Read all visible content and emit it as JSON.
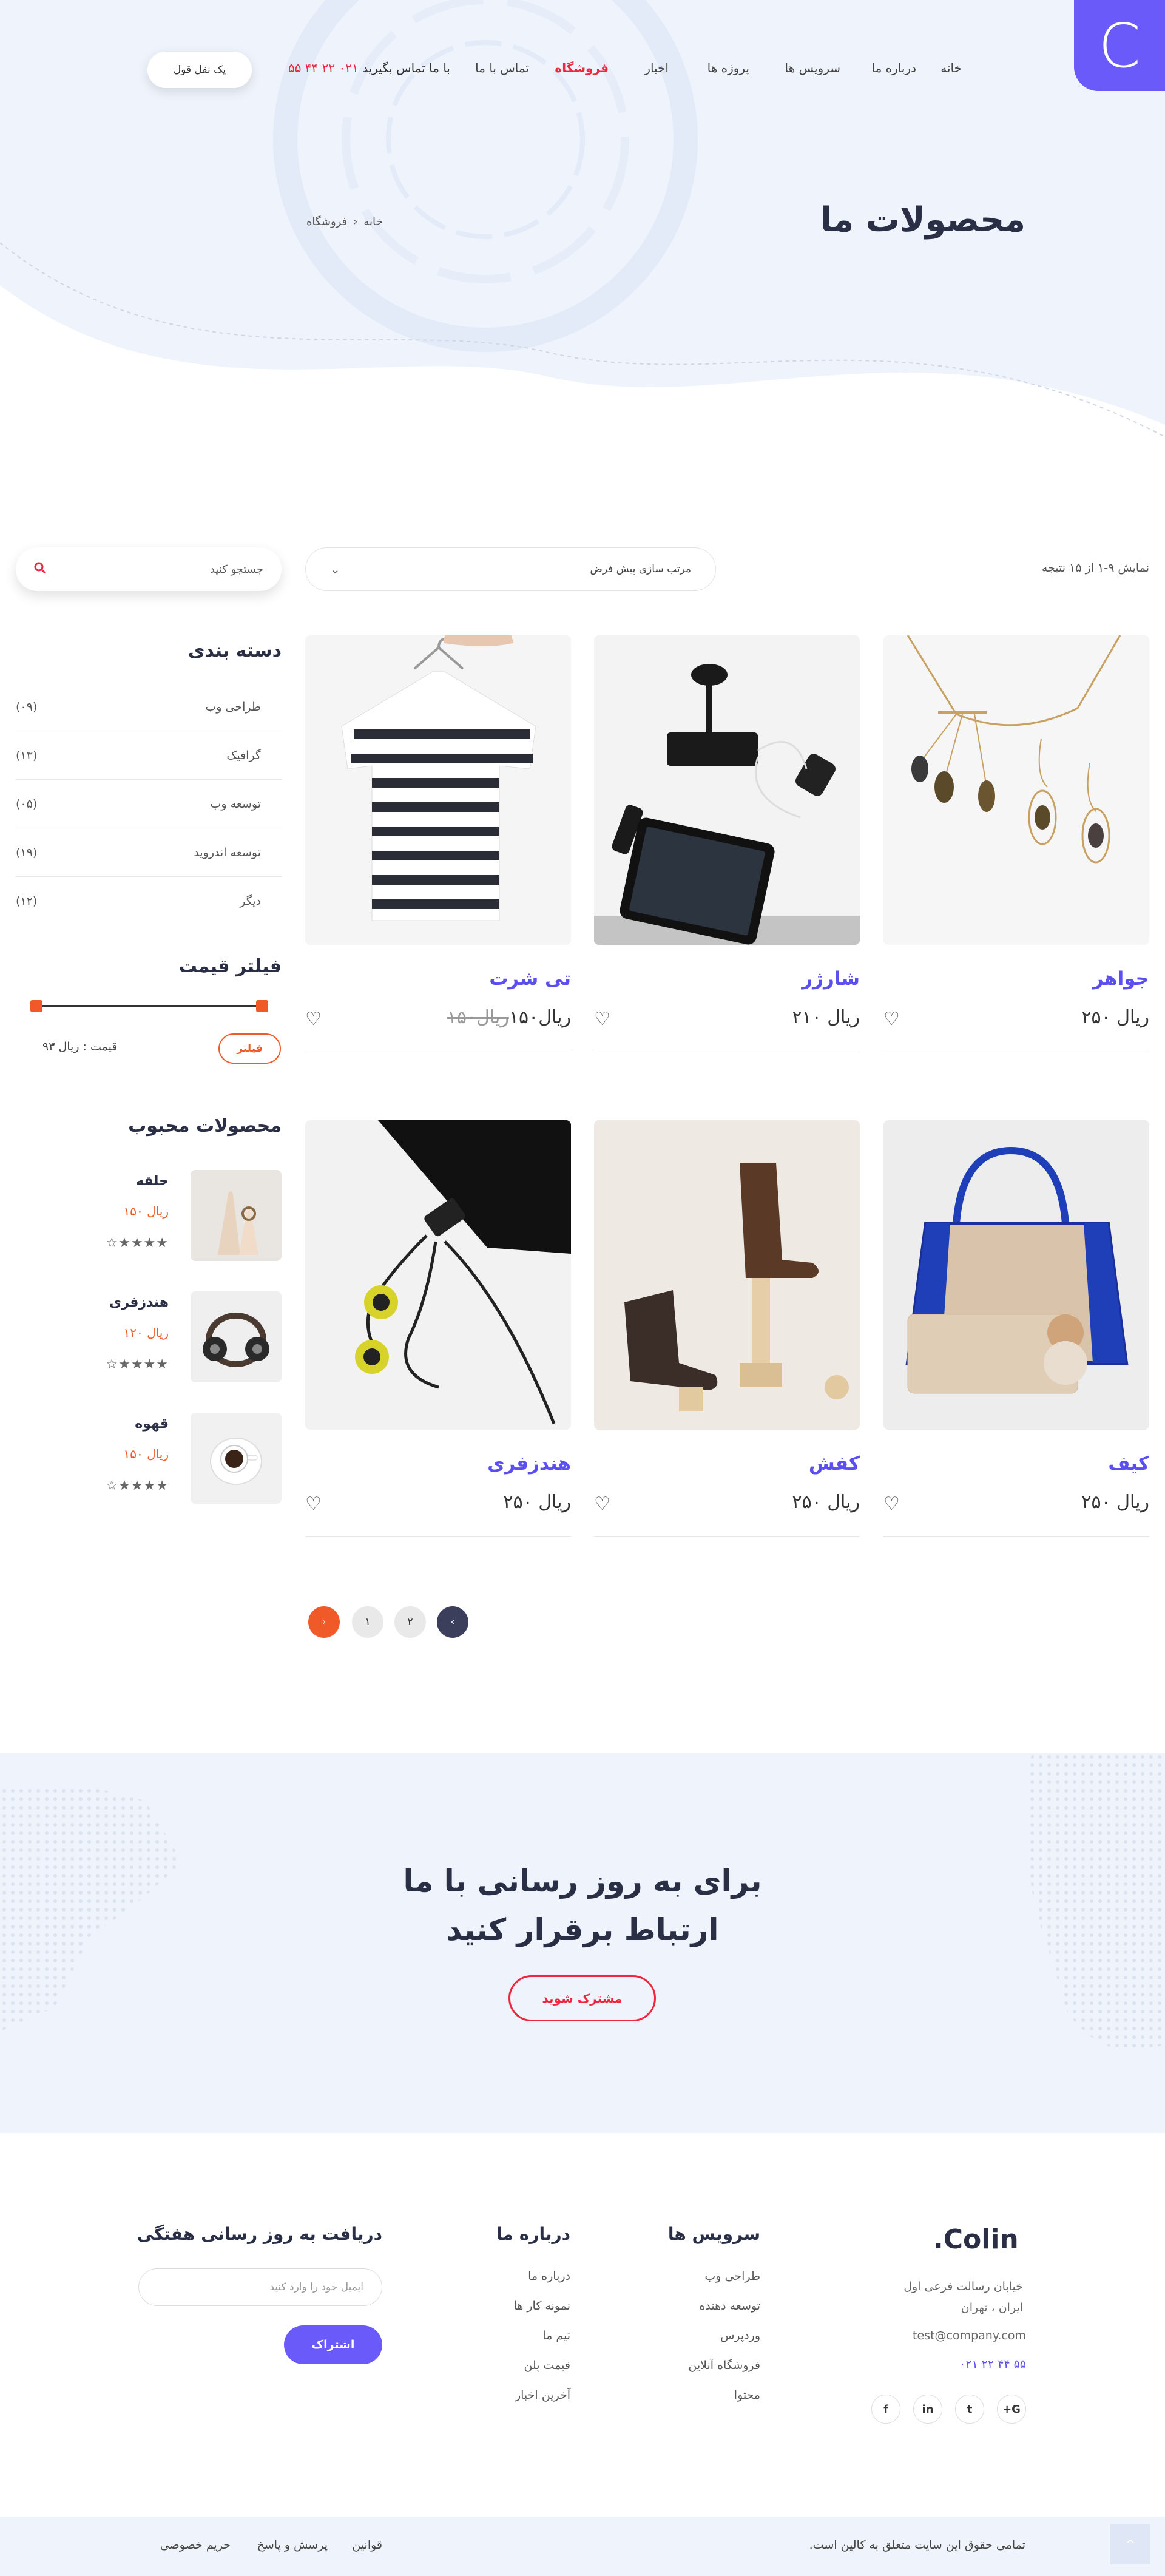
{
  "header": {
    "logo": "C",
    "nav": [
      "خانه",
      "درباره ما",
      "سرویس ها",
      "پروژه ها",
      "اخبار",
      "فروشگاه",
      "تماس با ما"
    ],
    "active_nav": "فروشگاه",
    "phone_label": "با ما تماس بگیرید",
    "phone_number": "۰۲۱ ۲۲ ۴۴ ۵۵",
    "cta": "یک نقل قول"
  },
  "hero": {
    "title": "محصولات ما",
    "breadcrumb": [
      "خانه",
      "فروشگاه"
    ]
  },
  "toolbar": {
    "results": "نمایش ۹-۱ از ۱۵ نتیجه",
    "sort_value": "مرتب سازی پیش فرض",
    "search_placeholder": "جستجو کنید"
  },
  "sidebar": {
    "categories_title": "دسته بندی",
    "categories": [
      {
        "name": "طراحی وب",
        "count": "(۰۹)"
      },
      {
        "name": "گرافیک",
        "count": "(۱۳)"
      },
      {
        "name": "توسعه وب",
        "count": "(۰۵)"
      },
      {
        "name": "توسعه اندروید",
        "count": "(۱۹)"
      },
      {
        "name": "دیگر",
        "count": "(۱۲)"
      }
    ],
    "price_title": "فیلتر قیمت",
    "filter_button": "فیلتر",
    "price_label": "قیمت :  ریال ۹۳",
    "price_range_fraction": [
      0,
      1
    ],
    "popular_title": "محصولات محبوب",
    "popular": [
      {
        "name": "حلقه",
        "price": "ریال ۱۵۰",
        "stars": "☆★★★★",
        "rating": 4
      },
      {
        "name": "هندزفری",
        "price": "ریال ۱۲۰",
        "stars": "☆★★★★",
        "rating": 4
      },
      {
        "name": "قهوه",
        "price": "ریال ۱۵۰",
        "stars": "☆★★★★",
        "rating": 4
      }
    ]
  },
  "products": [
    {
      "name": "جواهر",
      "price": "ریال ۲۵۰",
      "old_price": ""
    },
    {
      "name": "شارژر",
      "price": "ریال ۲۱۰",
      "old_price": ""
    },
    {
      "name": "تی شرت",
      "price": "ریال۱۵۰",
      "old_price": "ریال۱۵۰"
    },
    {
      "name": "کیف",
      "price": "ریال ۲۵۰",
      "old_price": ""
    },
    {
      "name": "کفش",
      "price": "ریال ۲۵۰",
      "old_price": ""
    },
    {
      "name": "هندزفری",
      "price": "ریال ۲۵۰",
      "old_price": ""
    }
  ],
  "pagination": {
    "prev": "‹",
    "pages": [
      "۱",
      "۲"
    ],
    "next": "›"
  },
  "newsletter": {
    "title_line1": "برای به روز رسانی با ما",
    "title_line2": "ارتباط برقرار کنید",
    "button": "مشترک شوید"
  },
  "footer": {
    "logo": "Colin.",
    "address_line1": "خیابان رسالت فرعی اول",
    "address_line2": "ایران ، تهران",
    "email": "test@company.com",
    "phone": "۰۲۱ ۲۲ ۴۴ ۵۵",
    "services_title": "سرویس ها",
    "services": [
      "طراحی وب",
      "توسعه دهنده",
      "وردپرس",
      "فروشگاه آنلاین",
      "محتوا"
    ],
    "about_title": "درباره ما",
    "about": [
      "درباره ما",
      "نمونه کار ها",
      "تیم ما",
      "قیمت پلن",
      "آخرین اخبار"
    ],
    "newsletter_title": "دریافت به روز رسانی هفتگی",
    "email_placeholder": "ایمیل خود را وارد کنید",
    "subscribe": "اشتراک",
    "social": [
      "G+",
      "t",
      "in",
      "f"
    ]
  },
  "bottom": {
    "copyright": "تمامی حقوق این سایت متعلق به کالین است.",
    "links": [
      "قوانین",
      "پرسش و پاسخ",
      "حریم خصوصی"
    ],
    "to_top": "^"
  },
  "colors": {
    "accent": "#6a5af9",
    "red": "#f0263e",
    "orange": "#f05a28",
    "bg_light": "#eef3fc"
  }
}
